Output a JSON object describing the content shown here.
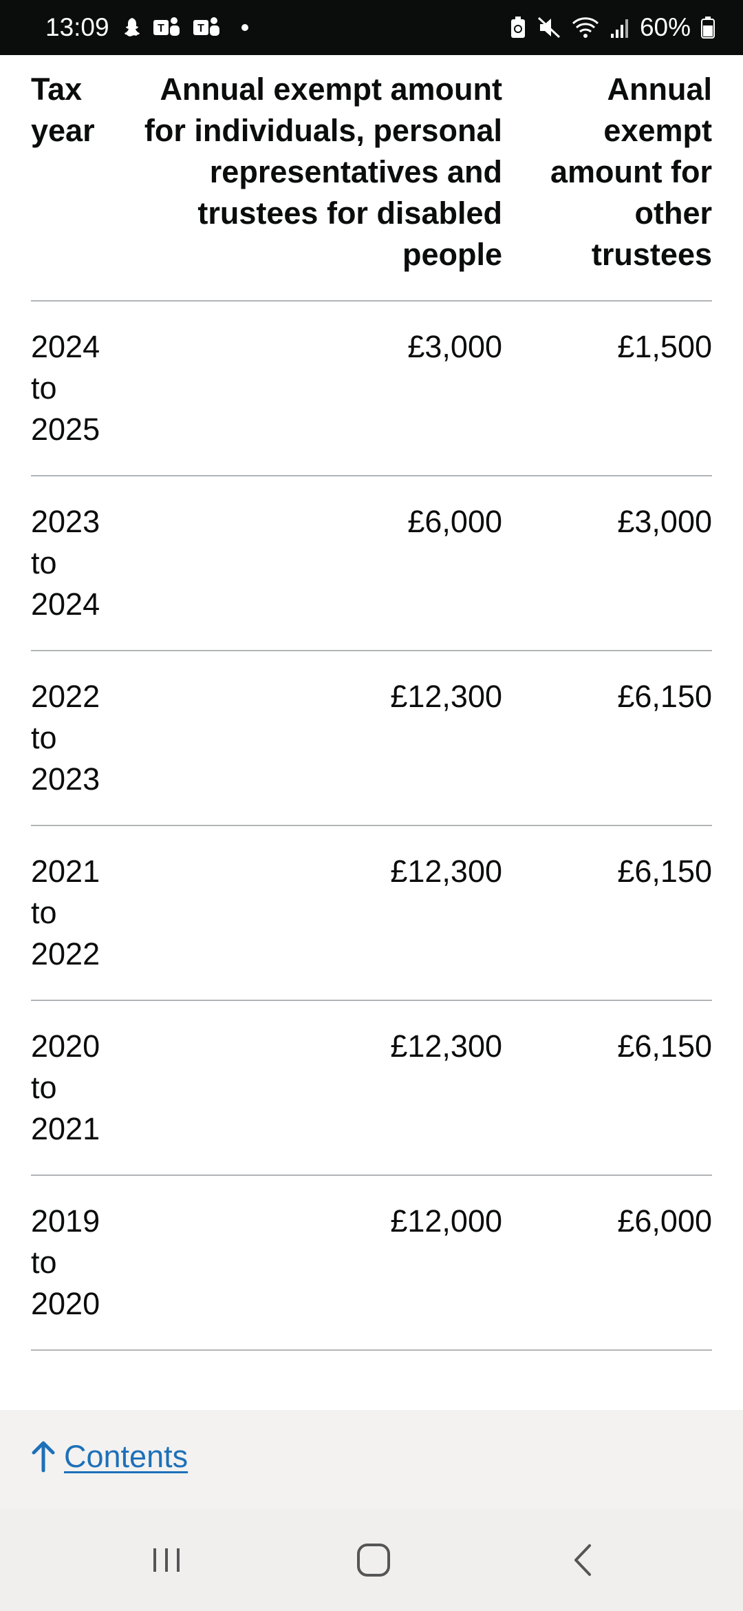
{
  "status_bar": {
    "time": "13:09",
    "battery": "60%",
    "left_icons": [
      "snapchat-icon",
      "teams-icon",
      "teams-icon",
      "notification-dot"
    ],
    "right_icons": [
      "battery-saver-icon",
      "mute-icon",
      "wifi-icon",
      "signal-icon",
      "battery-icon"
    ]
  },
  "table": {
    "headers": {
      "tax_year": "Tax year",
      "individuals": "Annual exempt amount for individuals, personal representatives and trustees for disabled people",
      "other_trustees": "Annual exempt amount for other trustees"
    },
    "rows": [
      {
        "year": "2024 to 2025",
        "individuals": "£3,000",
        "other": "£1,500"
      },
      {
        "year": "2023 to 2024",
        "individuals": "£6,000",
        "other": "£3,000"
      },
      {
        "year": "2022 to 2023",
        "individuals": "£12,300",
        "other": "£6,150"
      },
      {
        "year": "2021 to 2022",
        "individuals": "£12,300",
        "other": "£6,150"
      },
      {
        "year": "2020 to 2021",
        "individuals": "£12,300",
        "other": "£6,150"
      },
      {
        "year": "2019 to 2020",
        "individuals": "£12,000",
        "other": "£6,000"
      }
    ]
  },
  "footer": {
    "contents_label": "Contents",
    "contents_icon": "arrow-up-icon"
  },
  "nav_bar": {
    "buttons": [
      "recent-apps-icon",
      "home-icon",
      "back-icon"
    ]
  },
  "colors": {
    "link": "#1d70b8",
    "text": "#0b0c0c",
    "divider": "#b1b4b6",
    "footer_bg": "#f3f2f1",
    "status_bg": "#0b0c0c"
  }
}
